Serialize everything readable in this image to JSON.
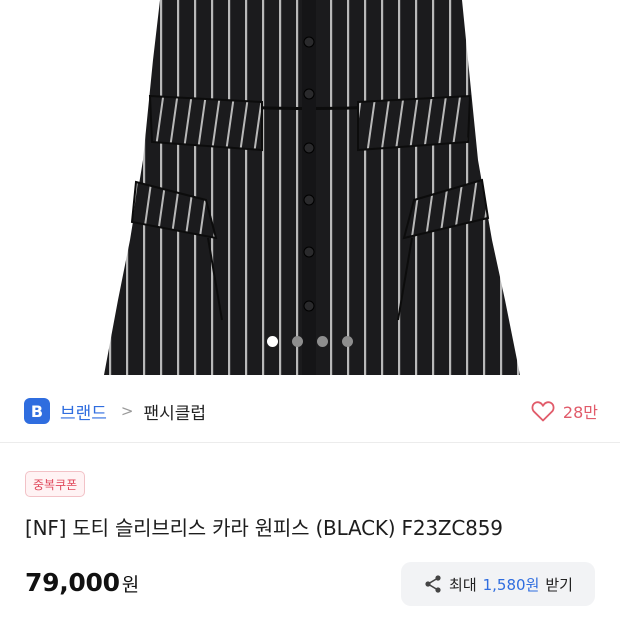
{
  "carousel": {
    "total_slides": 4,
    "active_index": 0
  },
  "brand_bar": {
    "badge_letter": "B",
    "brand_label": "브랜드",
    "separator": ">",
    "store_name": "팬시클럽",
    "like_count": "28만"
  },
  "product": {
    "coupon_badge": "중복쿠폰",
    "title": "[NF] 도티 슬리브리스 카라 원피스 (BLACK) F23ZC859",
    "price": "79,000",
    "price_unit": "원"
  },
  "share_reward": {
    "prefix": "최대",
    "amount": "1,580원",
    "suffix": "받기"
  },
  "icons": {
    "heart": "heart-icon",
    "share": "share-icon"
  },
  "colors": {
    "accent_blue": "#2f6ddf",
    "coupon_red": "#e0495c",
    "heart_red": "#e15b6a"
  }
}
